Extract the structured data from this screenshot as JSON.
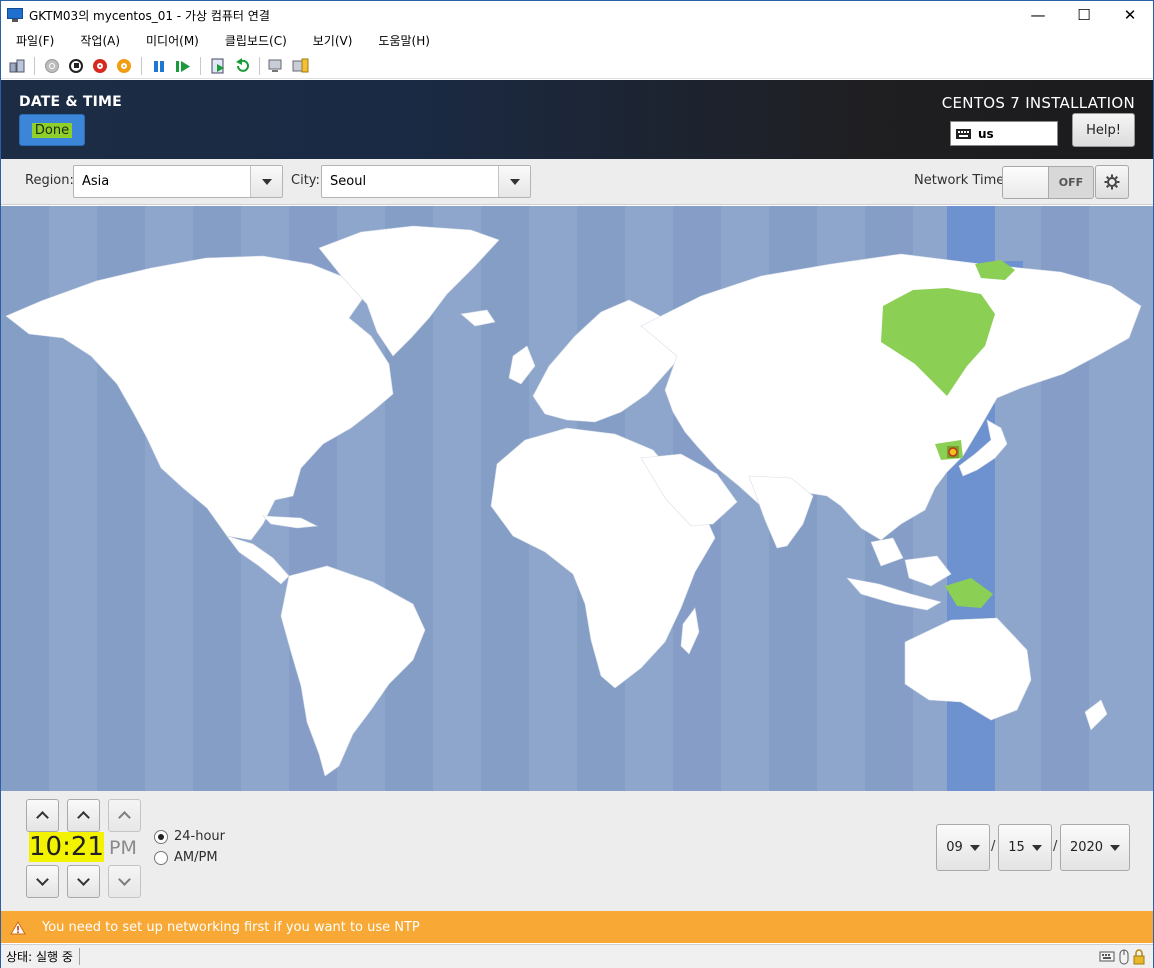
{
  "window": {
    "title": "GKTM03의 mycentos_01 - 가상 컴퓨터 연결",
    "minimize": "—",
    "maximize": "☐",
    "close": "✕"
  },
  "menu": [
    "파일(F)",
    "작업(A)",
    "미디어(M)",
    "클립보드(C)",
    "보기(V)",
    "도움말(H)"
  ],
  "header": {
    "spoke_title": "DATE & TIME",
    "done_label": "Done",
    "product": "CENTOS 7 INSTALLATION",
    "keyboard_layout": "us",
    "help_label": "Help!"
  },
  "region_bar": {
    "region_label": "Region:",
    "region_value": "Asia",
    "city_label": "City:",
    "city_value": "Seoul",
    "network_time_label": "Network Time",
    "network_time_state": "OFF"
  },
  "time": {
    "value": "10:21",
    "ampm": "PM",
    "format_24": "24-hour",
    "format_ampm": "AM/PM",
    "selected_format": "24-hour"
  },
  "date": {
    "month": "09",
    "day": "15",
    "year": "2020",
    "separator": "/"
  },
  "warning": {
    "text": "You need to set up networking first if you want to use NTP"
  },
  "statusbar": {
    "text": "상태: 실행 중"
  },
  "colors": {
    "ocean": "#8ea6cc",
    "selected_zone": "#6d92cf",
    "highlight_land": "#8ccf55",
    "done_button": "#3b86d8",
    "warning": "#f8a835"
  }
}
